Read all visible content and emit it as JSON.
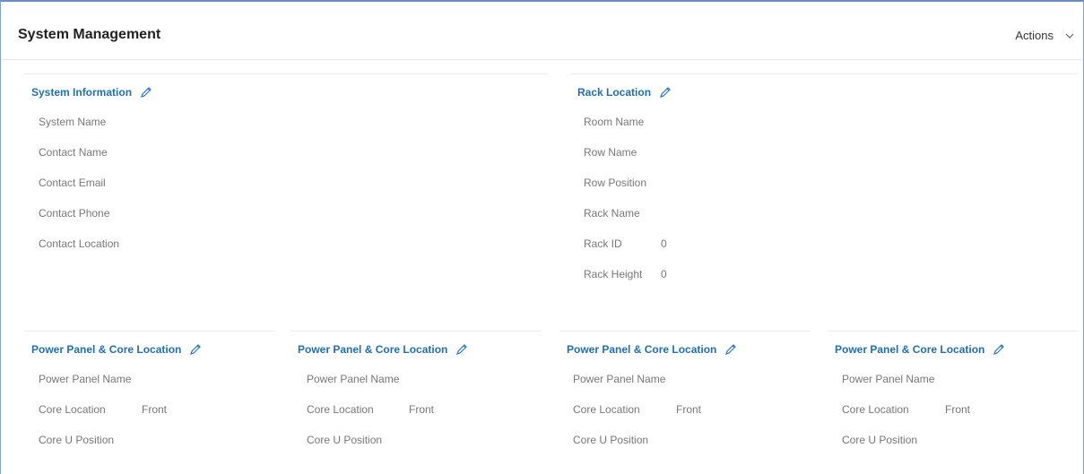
{
  "header": {
    "title": "System Management",
    "actions_label": "Actions"
  },
  "system_info": {
    "title": "System Information",
    "fields": [
      "System Name",
      "Contact Name",
      "Contact Email",
      "Contact Phone",
      "Contact Location"
    ]
  },
  "rack_location": {
    "title": "Rack Location",
    "fields": [
      "Room Name",
      "Row Name",
      "Row Position",
      "Rack Name",
      "Rack ID",
      "Rack Height"
    ],
    "rack_id_value": "0",
    "rack_height_value": "0"
  },
  "power_panels": [
    {
      "title": "Power Panel & Core Location",
      "power_panel_name": "Power Panel Name",
      "core_location": "Core Location",
      "core_location_value": "Front",
      "core_u_position": "Core U Position"
    },
    {
      "title": "Power Panel & Core Location",
      "power_panel_name": "Power Panel Name",
      "core_location": "Core Location",
      "core_location_value": "Front",
      "core_u_position": "Core U Position"
    },
    {
      "title": "Power Panel & Core Location",
      "power_panel_name": "Power Panel Name",
      "core_location": "Core Location",
      "core_location_value": "Front",
      "core_u_position": "Core U Position"
    },
    {
      "title": "Power Panel & Core Location",
      "power_panel_name": "Power Panel Name",
      "core_location": "Core Location",
      "core_location_value": "Front",
      "core_u_position": "Core U Position"
    }
  ],
  "icons": {
    "edit": "pencil-icon",
    "dropdown": "chevron-down-icon"
  },
  "colors": {
    "section_title": "#1f6fb2",
    "label": "#777777",
    "frame_border": "#6b8fbd"
  }
}
